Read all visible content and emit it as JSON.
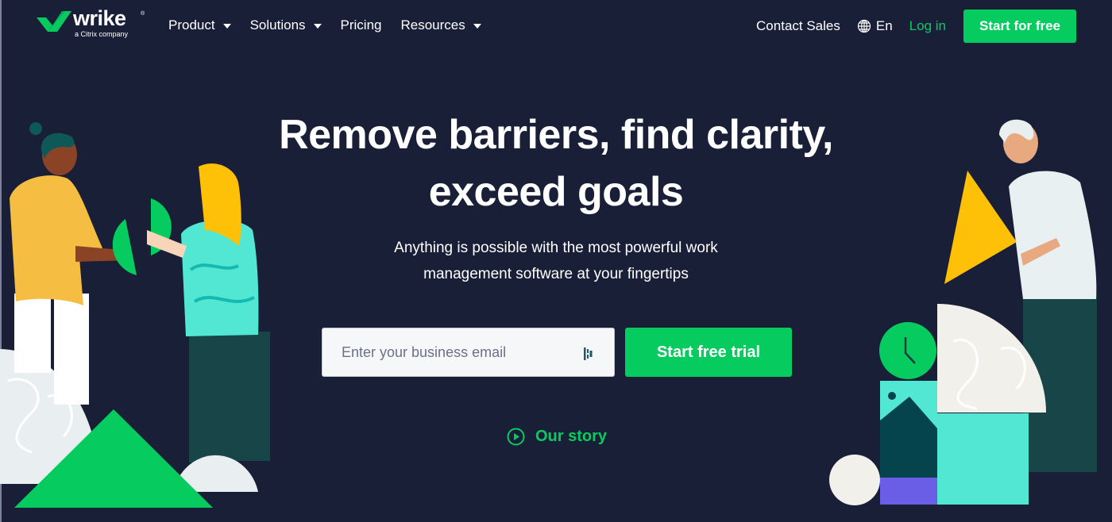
{
  "brand": {
    "name": "wrike",
    "registered": "®",
    "tagline": "a Citrix company",
    "accent_color": "#06cc60",
    "background_color": "#1a1f38"
  },
  "nav": {
    "menu": [
      {
        "label": "Product",
        "has_dropdown": true
      },
      {
        "label": "Solutions",
        "has_dropdown": true
      },
      {
        "label": "Pricing",
        "has_dropdown": false
      },
      {
        "label": "Resources",
        "has_dropdown": true
      }
    ],
    "contact_label": "Contact Sales",
    "language_icon": "globe-icon",
    "language_label": "En",
    "login_label": "Log in",
    "cta_label": "Start for free"
  },
  "hero": {
    "title_line1": "Remove barriers, find clarity,",
    "title_line2": "exceed goals",
    "subtitle_line1": "Anything is possible with the most powerful work",
    "subtitle_line2": "management software at your fingertips",
    "email_placeholder": "Enter your business email",
    "email_value": "",
    "trial_label": "Start free trial",
    "story_icon": "play-circle-icon",
    "story_label": "Our story"
  }
}
